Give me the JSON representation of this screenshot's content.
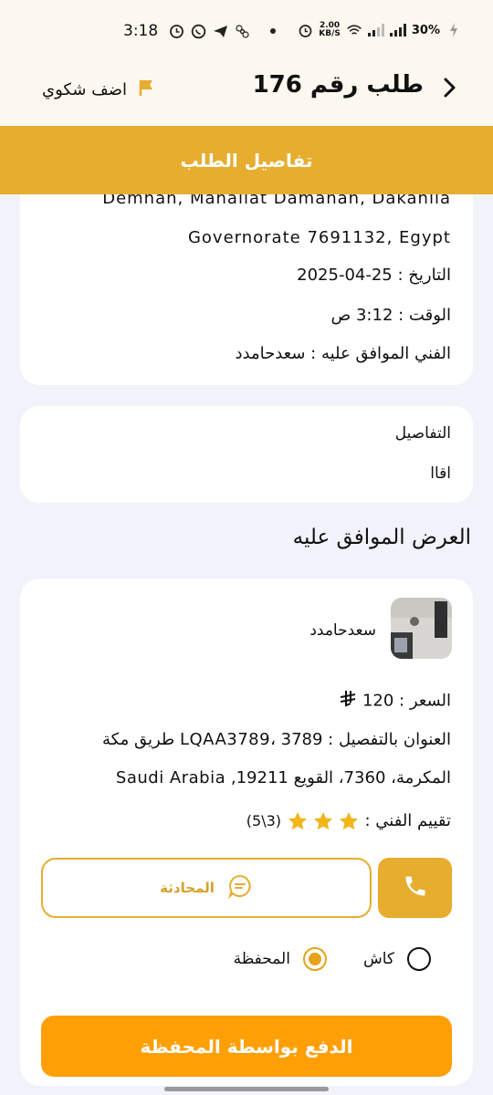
{
  "status_bar": {
    "time": "3:18",
    "net_speed_value": "2.00",
    "net_speed_unit": "KB/S",
    "battery": "30%"
  },
  "app_bar": {
    "title": "طلب رقم 176",
    "complaint_label": "اضف شكوي"
  },
  "banner": {
    "title": "تفاصيل الطلب"
  },
  "order_info": {
    "address_line1": "Demnah, Mahallat Damanah, Dakahlia",
    "address_line2": "Governorate 7691132, Egypt",
    "date_label": "التاريخ :",
    "date_value": "25-04-2025",
    "time_label": "الوقت :",
    "time_value": "3:12 ص",
    "tech_label": "الفني الموافق عليه :",
    "tech_value": "سعدحامدد"
  },
  "details": {
    "label": "التفاصيل",
    "value": "اقاا"
  },
  "accepted_offer": {
    "section_title": "العرض الموافق عليه",
    "technician_name": "سعدحامدد",
    "price_label": "السعر :",
    "price_value": "120",
    "address_label": "العنوان بالتفصيل :",
    "address_line1": "LQAA3789، 3789 طريق مكة",
    "address_line2": "المكرمة، 7360، القويع 19211, Saudi Arabia",
    "rating_label": "تقييم الفني :",
    "rating_value": 3,
    "rating_max": 5,
    "rating_text": "(3\\5)",
    "chat_label": "المحادثة",
    "payment_options": [
      "كاش",
      "المحفظة"
    ],
    "selected_payment": "المحفظة",
    "pay_button_label": "الدفع بواسطة المحفظة"
  },
  "colors": {
    "accent": "#e6ad2f",
    "pay_button": "#ff9f06",
    "header_bg": "#fcf8ef",
    "page_bg": "#f1f2fa",
    "star": "#f2b51c"
  }
}
